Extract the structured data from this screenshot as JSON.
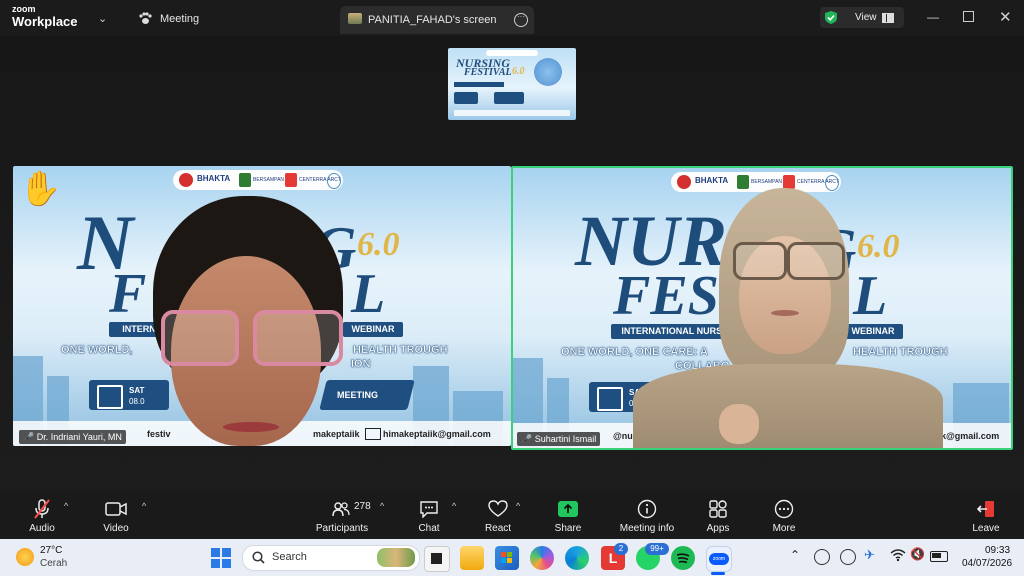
{
  "titlebar": {
    "brand_top": "zoom",
    "brand_bottom": "Workplace",
    "tabs": [
      {
        "label": "Meeting"
      },
      {
        "label": "PANITIA_FAHAD's screen"
      }
    ],
    "view_label": "View"
  },
  "shared_screen": {
    "title_line1": "NURSING",
    "title_line2": "FESTIVAL",
    "edition": "6.0"
  },
  "participants": [
    {
      "name": "Dr. Indriani Yauri, MN",
      "banner_letters_left": "N",
      "banner_letters_right": "G",
      "edition": "6.0",
      "banner_f": "F",
      "banner_l": "L",
      "international": "INTERN",
      "webinar": "WEBINAR",
      "slogan_left": "ONE WORLD,",
      "slogan_right": "HEALTH TROUGH",
      "slogan_line2": "ION",
      "date_text": "SAT",
      "date_sub": "08.0",
      "meeting_label": "MEETING",
      "email_left": "festiv",
      "handle": "makeptaiik",
      "email": "himakeptaiik@gmail.com",
      "hand_raised": true
    },
    {
      "name": "Suhartini Ismail",
      "banner_letters": "NURS",
      "banner_letters_right": "G",
      "edition": "6.0",
      "banner_f": "FES",
      "banner_l": "L",
      "international": "INTERNATIONAL NURSI",
      "webinar": "WEBINAR",
      "slogan_left": "ONE WORLD, ONE CARE: A",
      "slogan_right": "HEALTH TROUGH",
      "slogan_line2": "COLLABO",
      "date_text": "SAT",
      "date_sub": "08.0",
      "email_left": "@nu",
      "email_right": "k@gmail.com",
      "active_speaker": true
    }
  ],
  "banner_sponsors": [
    "BHAKTA",
    "BERSAMPAN",
    "CENTERRA ARCT"
  ],
  "toolbar": {
    "audio": "Audio",
    "video": "Video",
    "participants": "Participants",
    "participant_count": "278",
    "chat": "Chat",
    "react": "React",
    "share": "Share",
    "meeting_info": "Meeting info",
    "apps": "Apps",
    "more": "More",
    "leave": "Leave"
  },
  "taskbar": {
    "temperature": "27°C",
    "weather": "Cerah",
    "search_placeholder": "Search",
    "whatsapp_badge": "99+",
    "l_badge": "2",
    "time": "09:33",
    "date": "04/07/2026"
  },
  "colors": {
    "active_border": "#38d27a",
    "share_green": "#22c55e",
    "banner_navy": "#1f4f80",
    "gold": "#e0b64a"
  }
}
